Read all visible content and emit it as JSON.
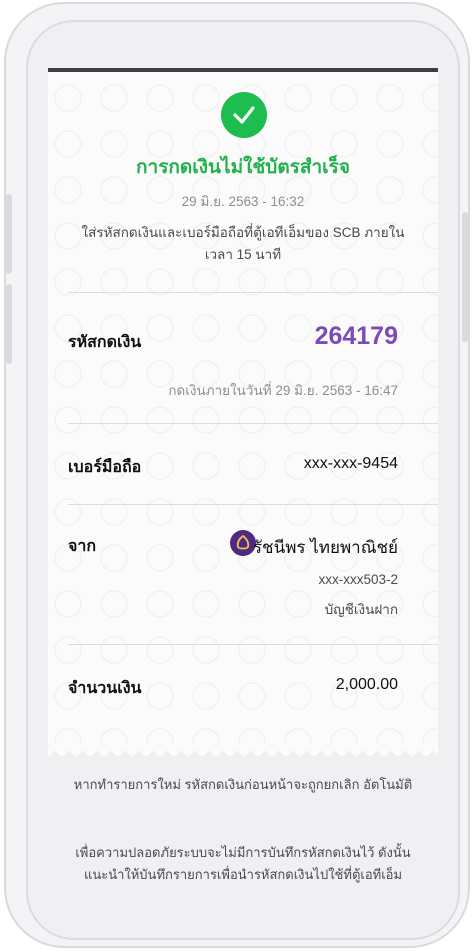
{
  "receipt": {
    "title": "การกดเงินไม่ใช้บัตรสำเร็จ",
    "timestamp": "29 มิ.ย. 2563 - 16:32",
    "instruction": "ใส่รหัสกดเงินและเบอร์มือถือที่ตู้เอทีเอ็มของ SCB ภายใน เวลา 15 นาที",
    "code_label": "รหัสกดเงิน",
    "code_value": "264179",
    "code_expiry": "กดเงินภายในวันที่ 29 มิ.ย. 2563 - 16:47",
    "phone_label": "เบอร์มือถือ",
    "phone_value": "xxx-xxx-9454",
    "from_label": "จาก",
    "from_name": "รัชนีพร ไทยพาณิชย์",
    "from_account": "xxx-xxx503-2",
    "from_account_type": "บัญชีเงินฝาก",
    "amount_label": "จำนวนเงิน",
    "amount_value": "2,000.00"
  },
  "footer": {
    "note1": "หากทำรายการใหม่ รหัสกดเงินก่อนหน้าจะถูกยกเลิก อัตโนมัติ",
    "note2": "เพื่อความปลอดภัยระบบจะไม่มีการบันทึกรหัสกดเงินไว้ ดังนั้นแนะนำให้บันทึกรายการเพื่อนำรหัสกดเงินไปใช้ที่ตู้เอทีเอ็ม"
  },
  "icons": {
    "success": "check-icon",
    "bank": "scb-logo-icon"
  },
  "colors": {
    "success_green": "#1ebd4f",
    "code_purple": "#7b4bb8",
    "bank_purple": "#4e2a84"
  }
}
